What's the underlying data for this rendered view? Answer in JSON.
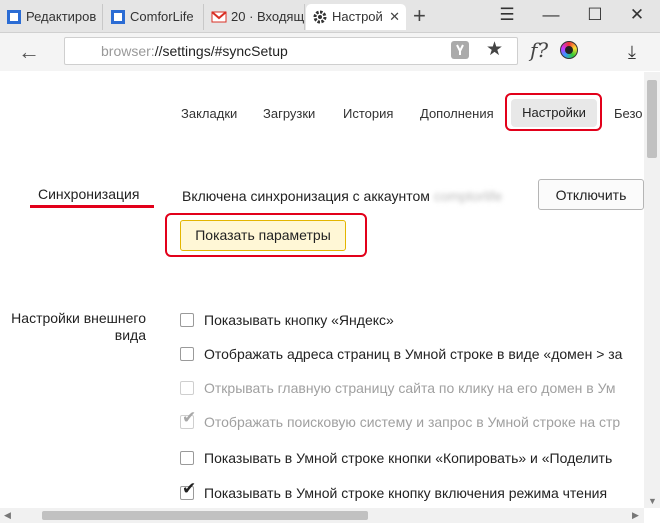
{
  "tabs": [
    {
      "title": "Редактиров",
      "icon": "word-doc-icon",
      "active": false
    },
    {
      "title": "ComforLife",
      "icon": "word-doc-icon",
      "active": false
    },
    {
      "title": "20 · Входящ",
      "icon": "gmail-icon",
      "active": false
    },
    {
      "title": "Настрой",
      "icon": "gear-icon",
      "active": true
    }
  ],
  "toolbar": {
    "url_scheme": "browser:",
    "url_path": "//settings/#syncSetup"
  },
  "nav": {
    "items": [
      "Закладки",
      "Загрузки",
      "История",
      "Дополнения"
    ],
    "active": "Настройки",
    "partial": "Безо"
  },
  "sync": {
    "title": "Синхронизация",
    "status_text": "Включена синхронизация с аккаунтом",
    "account": "comptorlife",
    "disconnect_label": "Отключить",
    "show_params_label": "Показать параметры"
  },
  "appearance": {
    "title_line1": "Настройки внешнего",
    "title_line2": "вида",
    "options": [
      {
        "label": "Показывать кнопку «Яндекс»",
        "checked": false,
        "disabled": false
      },
      {
        "label": "Отображать адреса страниц в Умной строке в виде «домен > за",
        "checked": false,
        "disabled": false
      },
      {
        "label": "Открывать главную страницу сайта по клику на его домен в Ум",
        "checked": false,
        "disabled": true
      },
      {
        "label": "Отображать поисковую систему и запрос в Умной строке на стр",
        "checked": true,
        "disabled": true
      },
      {
        "label": "Показывать в Умной строке кнопки «Копировать» и «Поделить",
        "checked": false,
        "disabled": false
      },
      {
        "label": "Показывать в Умной строке кнопку включения режима чтения",
        "checked": true,
        "disabled": false
      }
    ]
  },
  "colors": {
    "highlight_red": "#e2001a",
    "primary_button_bg": "#fff7d6",
    "primary_button_border": "#e3b500"
  }
}
